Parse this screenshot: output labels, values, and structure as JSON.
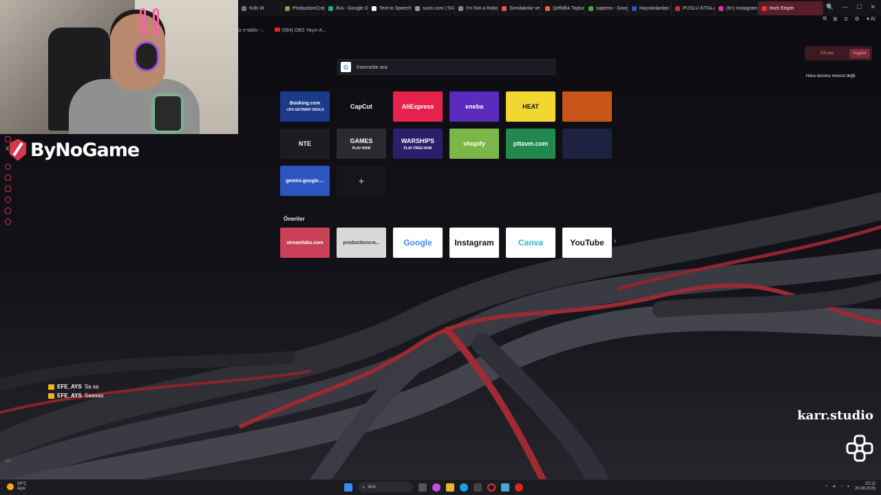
{
  "browser": {
    "tabs": [
      {
        "label": "Kids M",
        "color": "#777"
      },
      {
        "label": "ProductionCrat",
        "color": "#7a5"
      },
      {
        "label": "İKA - Google Dr",
        "color": "#2a8"
      },
      {
        "label": "Text to Speech",
        "color": "#fff"
      },
      {
        "label": "suno.com | 504",
        "color": "#999"
      },
      {
        "label": "I'm Not a Robot",
        "color": "#888"
      },
      {
        "label": "Simülakrlar ve S",
        "color": "#e55"
      },
      {
        "label": "Şeffaflık Toplum",
        "color": "#e63"
      },
      {
        "label": "sapiens - Goog",
        "color": "#4a4"
      },
      {
        "label": "Hayvanlardan T",
        "color": "#35c"
      },
      {
        "label": "PUSLU KITALAR",
        "color": "#c33"
      },
      {
        "label": "(9+) Instagram",
        "color": "#d3a"
      },
      {
        "label": "Hızlı Erişim",
        "color": "#e33"
      }
    ],
    "new_tab_symbol": "+",
    "window_controls": [
      "🔍",
      "—",
      "☐",
      "✕"
    ],
    "bookmarks": [
      "iz e-tablo -...",
      "(584) OBS Yayın A..."
    ],
    "toolbar_right": [
      "⧉",
      "⊞",
      "≣",
      "⚙",
      "✦AI"
    ]
  },
  "search": {
    "placeholder": "İnternette ara",
    "engine_letter": "G"
  },
  "speed_dial": [
    {
      "label": "Booking.com",
      "sub": "-15% GETAWAY DEALS",
      "bg": "#1a3a8a",
      "fg": "#ffffff"
    },
    {
      "label": "CapCut",
      "bg": "#101014",
      "fg": "#ffffff"
    },
    {
      "label": "AliExpress",
      "bg": "#e6224c",
      "fg": "#ffffff"
    },
    {
      "label": "eneba",
      "bg": "#5a2bbd",
      "fg": "#ffffff"
    },
    {
      "label": "HEAT",
      "bg": "#f2d730",
      "fg": "#111111"
    },
    {
      "label": "",
      "bg": "#c8561a",
      "fg": "#ffffff"
    },
    {
      "label": "NTE",
      "bg": "#1c1c22",
      "fg": "#ffffff"
    },
    {
      "label": "GAMES",
      "sub": "PLAY NOW",
      "bg": "#2a2a30",
      "fg": "#ffffff"
    },
    {
      "label": "WARSHIPS",
      "sub": "PLAY FREE NOW",
      "bg": "#2a1f6a",
      "fg": "#ffffff"
    },
    {
      "label": "shopify",
      "bg": "#7ab648",
      "fg": "#ffffff"
    },
    {
      "label": "pttavm.com",
      "bg": "#21884f",
      "fg": "#ffffff"
    },
    {
      "label": "",
      "bg": "#1d2240",
      "fg": "#ffffff"
    },
    {
      "label": "gemini.google....",
      "bg": "#2b56c0",
      "fg": "#ffffff"
    },
    {
      "label": "+",
      "bg": "#15151b",
      "fg": "#cccccc"
    }
  ],
  "suggestions_title": "Öneriler",
  "suggestions": [
    {
      "label": "streamlabs.com",
      "bg": "#c94058",
      "fg": "#ffffff"
    },
    {
      "label": "productioncra...",
      "bg": "#d8d8d8",
      "fg": "#333333"
    },
    {
      "label": "Google",
      "bg": "#ffffff",
      "fg": "#4285f4"
    },
    {
      "label": "Instagram",
      "bg": "#ffffff",
      "fg": "#111111"
    },
    {
      "label": "Canva",
      "bg": "#ffffff",
      "fg": "#26b9c8"
    },
    {
      "label": "YouTube",
      "bg": "#ffffff",
      "fg": "#111111"
    }
  ],
  "suggestions_next": "›",
  "gx_widget": {
    "label": "GX.me",
    "button": "Kaydol"
  },
  "weather_note": "Hava durumu mevcut değil.",
  "stream_logo": "ByNoGame",
  "chat": [
    {
      "user": "EFE_AYS",
      "msg": "Sa sa"
    },
    {
      "user": "EFE_AYS",
      "msg": "Saaaaa"
    }
  ],
  "watermark": "karr.studio",
  "sidebar_bottom": [
    "GX",
    "..."
  ],
  "taskbar": {
    "temp": "24°C",
    "weather": "Açık",
    "search": "Ara",
    "time": "23:12",
    "date": "25.08.2026"
  },
  "colors": {
    "accent": "#d73550",
    "tab_active": "#5a1d2a"
  }
}
